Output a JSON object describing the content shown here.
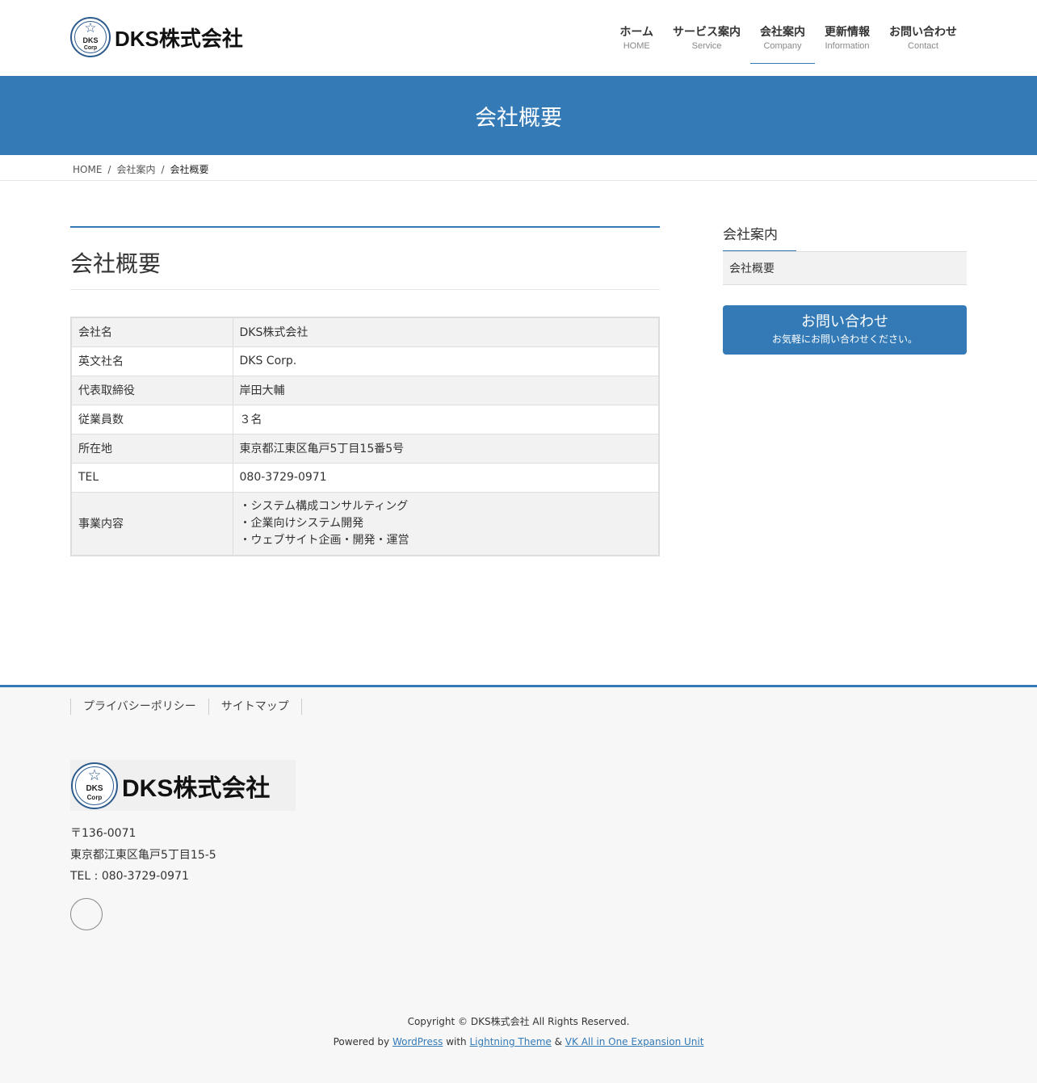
{
  "header": {
    "logo": {
      "badge_line1": "DKS",
      "badge_line2": "Corp",
      "star": "☆",
      "text": "DKS株式会社"
    },
    "nav": [
      {
        "label": "ホーム",
        "sub": "HOME"
      },
      {
        "label": "サービス案内",
        "sub": "Service"
      },
      {
        "label": "会社案内",
        "sub": "Company"
      },
      {
        "label": "更新情報",
        "sub": "Information"
      },
      {
        "label": "お問い合わせ",
        "sub": "Contact"
      }
    ],
    "active_nav": "会社案内"
  },
  "page_header": {
    "title": "会社概要"
  },
  "breadcrumb": {
    "home_icon": "home-icon",
    "home_icon_glyph": "",
    "home": "HOME",
    "sep": "/",
    "parent": "会社案内",
    "current": "会社概要"
  },
  "main": {
    "title": "会社概要",
    "table": [
      {
        "label": "会社名",
        "value": "DKS株式会社"
      },
      {
        "label": "英文社名",
        "value": "DKS Corp."
      },
      {
        "label": "代表取締役",
        "value": "岸田大輔"
      },
      {
        "label": "従業員数",
        "value": "３名"
      },
      {
        "label": "所在地",
        "value": "東京都江東区亀戸5丁目15番5号"
      },
      {
        "label": "TEL",
        "value": "080-3729-0971"
      },
      {
        "label": "事業内容",
        "lines": [
          "・システム構成コンサルティング",
          "・企業向けシステム開発",
          "・ウェブサイト企画・開発・運営"
        ]
      }
    ]
  },
  "sidebar": {
    "title": "会社案内",
    "menu_item": "会社概要",
    "contact_button": {
      "icon_left": "envelope-icon",
      "icon_right": "arrow-right-icon",
      "label": " お問い合わせ ",
      "sub": "お気軽にお問い合わせください。"
    }
  },
  "footer": {
    "links": [
      "プライバシーポリシー",
      "サイトマップ"
    ],
    "logo": {
      "badge_line1": "DKS",
      "badge_line2": "Corp",
      "star": "☆",
      "text": "DKS株式会社"
    },
    "postal": "〒136-0071",
    "address": "東京都江東区亀戸5丁目15-5",
    "tel": "TEL : 080-3729-0971",
    "social_icon": "facebook-icon",
    "social_glyph": "",
    "copyright": "Copyright © DKS株式会社 All Rights Reserved.",
    "powered": {
      "prefix": "Powered by ",
      "wp": "WordPress",
      "with": " with ",
      "theme": "Lightning Theme",
      "amp": " & ",
      "vk": "VK All in One Expansion Unit"
    }
  },
  "colors": {
    "accent": "#337ab7",
    "footer_bg": "#f7f7f7",
    "table_stripe": "#f2f2f2"
  }
}
